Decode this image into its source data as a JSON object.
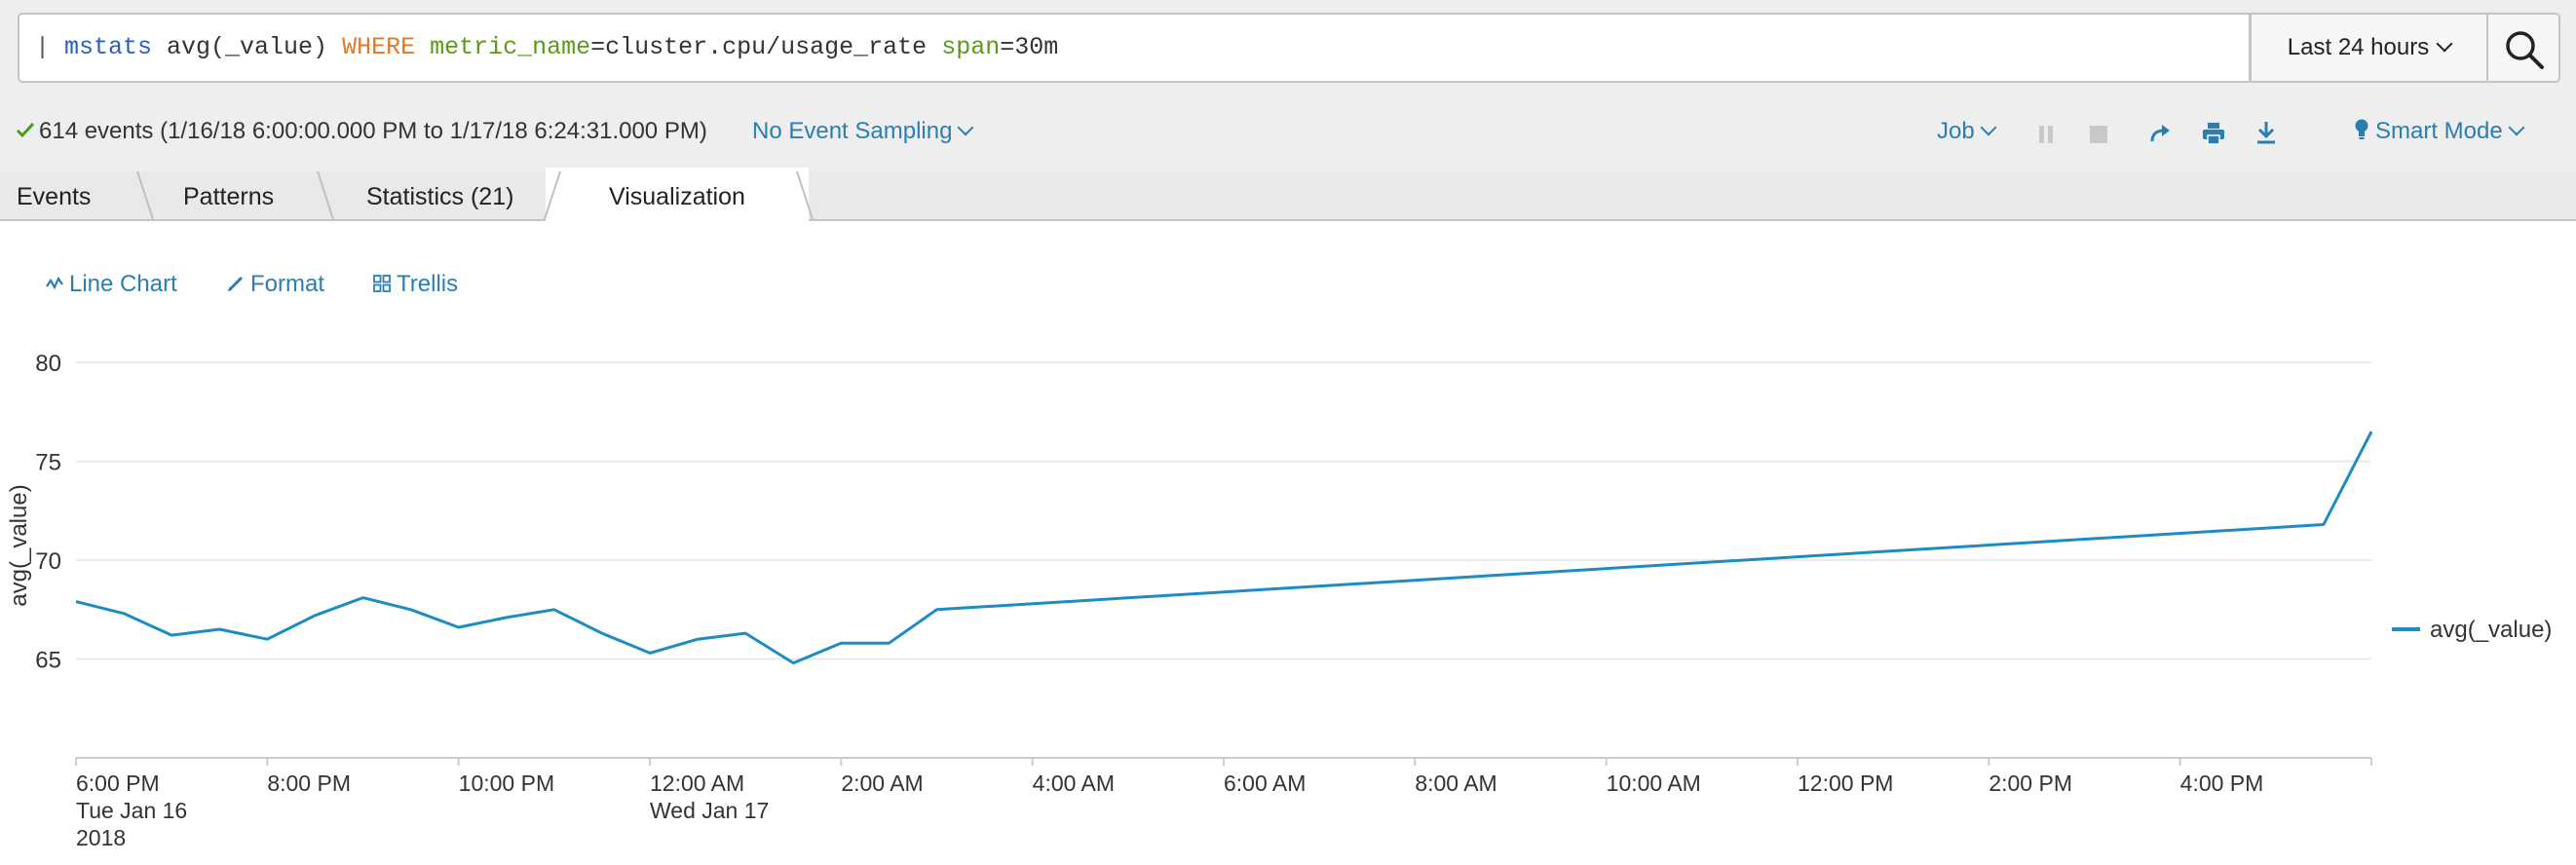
{
  "search": {
    "pipe": "| ",
    "command": "mstats",
    "function": " avg(_value) ",
    "where": "WHERE",
    "field1": " metric_name",
    "value1": "=cluster.cpu/usage_rate ",
    "field2": "span",
    "value2": "=30m"
  },
  "time_picker": {
    "label": "Last 24 hours"
  },
  "status": {
    "events": "614 events (1/16/18 6:00:00.000 PM to 1/17/18 6:24:31.000 PM)",
    "sampling": "No Event Sampling",
    "job": "Job",
    "mode": "Smart Mode"
  },
  "tabs": [
    "Events",
    "Patterns",
    "Statistics (21)",
    "Visualization"
  ],
  "viz_toolbar": {
    "chart_type": "Line Chart",
    "format": "Format",
    "trellis": "Trellis"
  },
  "colors": {
    "accent": "#2a7fb0",
    "series": "#1e8bc3"
  },
  "chart_data": {
    "type": "line",
    "ylabel": "avg(_value)",
    "ylim": [
      60,
      80
    ],
    "yticks": [
      65,
      70,
      75,
      80
    ],
    "x_tick_labels": [
      [
        "6:00 PM",
        "Tue Jan 16",
        "2018"
      ],
      [
        "8:00 PM"
      ],
      [
        "10:00 PM"
      ],
      [
        "12:00 AM",
        "Wed Jan 17"
      ],
      [
        "2:00 AM"
      ],
      [
        "4:00 AM"
      ],
      [
        "6:00 AM"
      ],
      [
        "8:00 AM"
      ],
      [
        "10:00 AM"
      ],
      [
        "12:00 PM"
      ],
      [
        "2:00 PM"
      ],
      [
        "4:00 PM"
      ]
    ],
    "x_tick_hours": [
      0,
      2,
      4,
      6,
      8,
      10,
      12,
      14,
      16,
      18,
      20,
      22
    ],
    "x_range_hours": [
      0,
      24
    ],
    "grid": true,
    "legend": "right",
    "series": [
      {
        "name": "avg(_value)",
        "x_hours": [
          0,
          0.5,
          1,
          1.5,
          2,
          2.5,
          3,
          3.5,
          4,
          4.5,
          5,
          5.5,
          6,
          6.5,
          7,
          7.5,
          8,
          8.5,
          9,
          23.5,
          24
        ],
        "values": [
          67.9,
          67.3,
          66.2,
          66.5,
          66.0,
          67.2,
          68.1,
          67.5,
          66.6,
          67.1,
          67.5,
          66.3,
          65.3,
          66.0,
          66.3,
          64.8,
          65.8,
          65.8,
          67.5,
          71.8,
          76.5
        ]
      }
    ]
  }
}
